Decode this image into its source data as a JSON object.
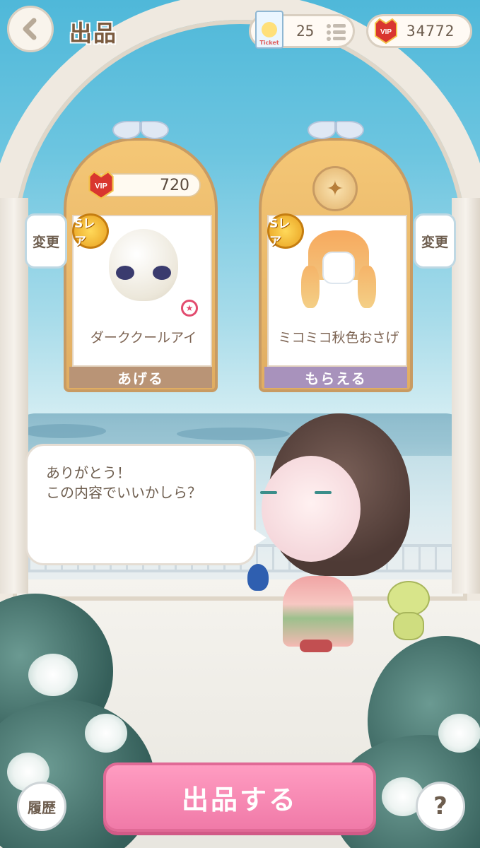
{
  "header": {
    "title": "出品",
    "ticket_count": "25",
    "vip_points": "34772",
    "ticket_badge_text": "Ticket"
  },
  "give_card": {
    "price_vip": "720",
    "rarity": "Sレア",
    "item_name": "ダーククールアイ",
    "label": "あげる"
  },
  "receive_card": {
    "rarity": "Sレア",
    "item_name": "ミコミコ秋色おさげ",
    "label": "もらえる"
  },
  "change_left": "変更",
  "change_right": "変更",
  "dialog": {
    "line1": "ありがとう！",
    "line2": "この内容でいいかしら？"
  },
  "footer": {
    "sell_button": "出品する",
    "history_button": "履歴",
    "help_button": "?"
  },
  "icons": [
    "back-arrow-icon",
    "ticket-icon",
    "list-icon",
    "vip-badge-icon",
    "sparkle-star-icon"
  ],
  "colors": {
    "accent_pink": "#f07aa8",
    "card_gold": "#e0ad62",
    "label_brown": "#b99476",
    "label_purple": "#a892bc"
  }
}
